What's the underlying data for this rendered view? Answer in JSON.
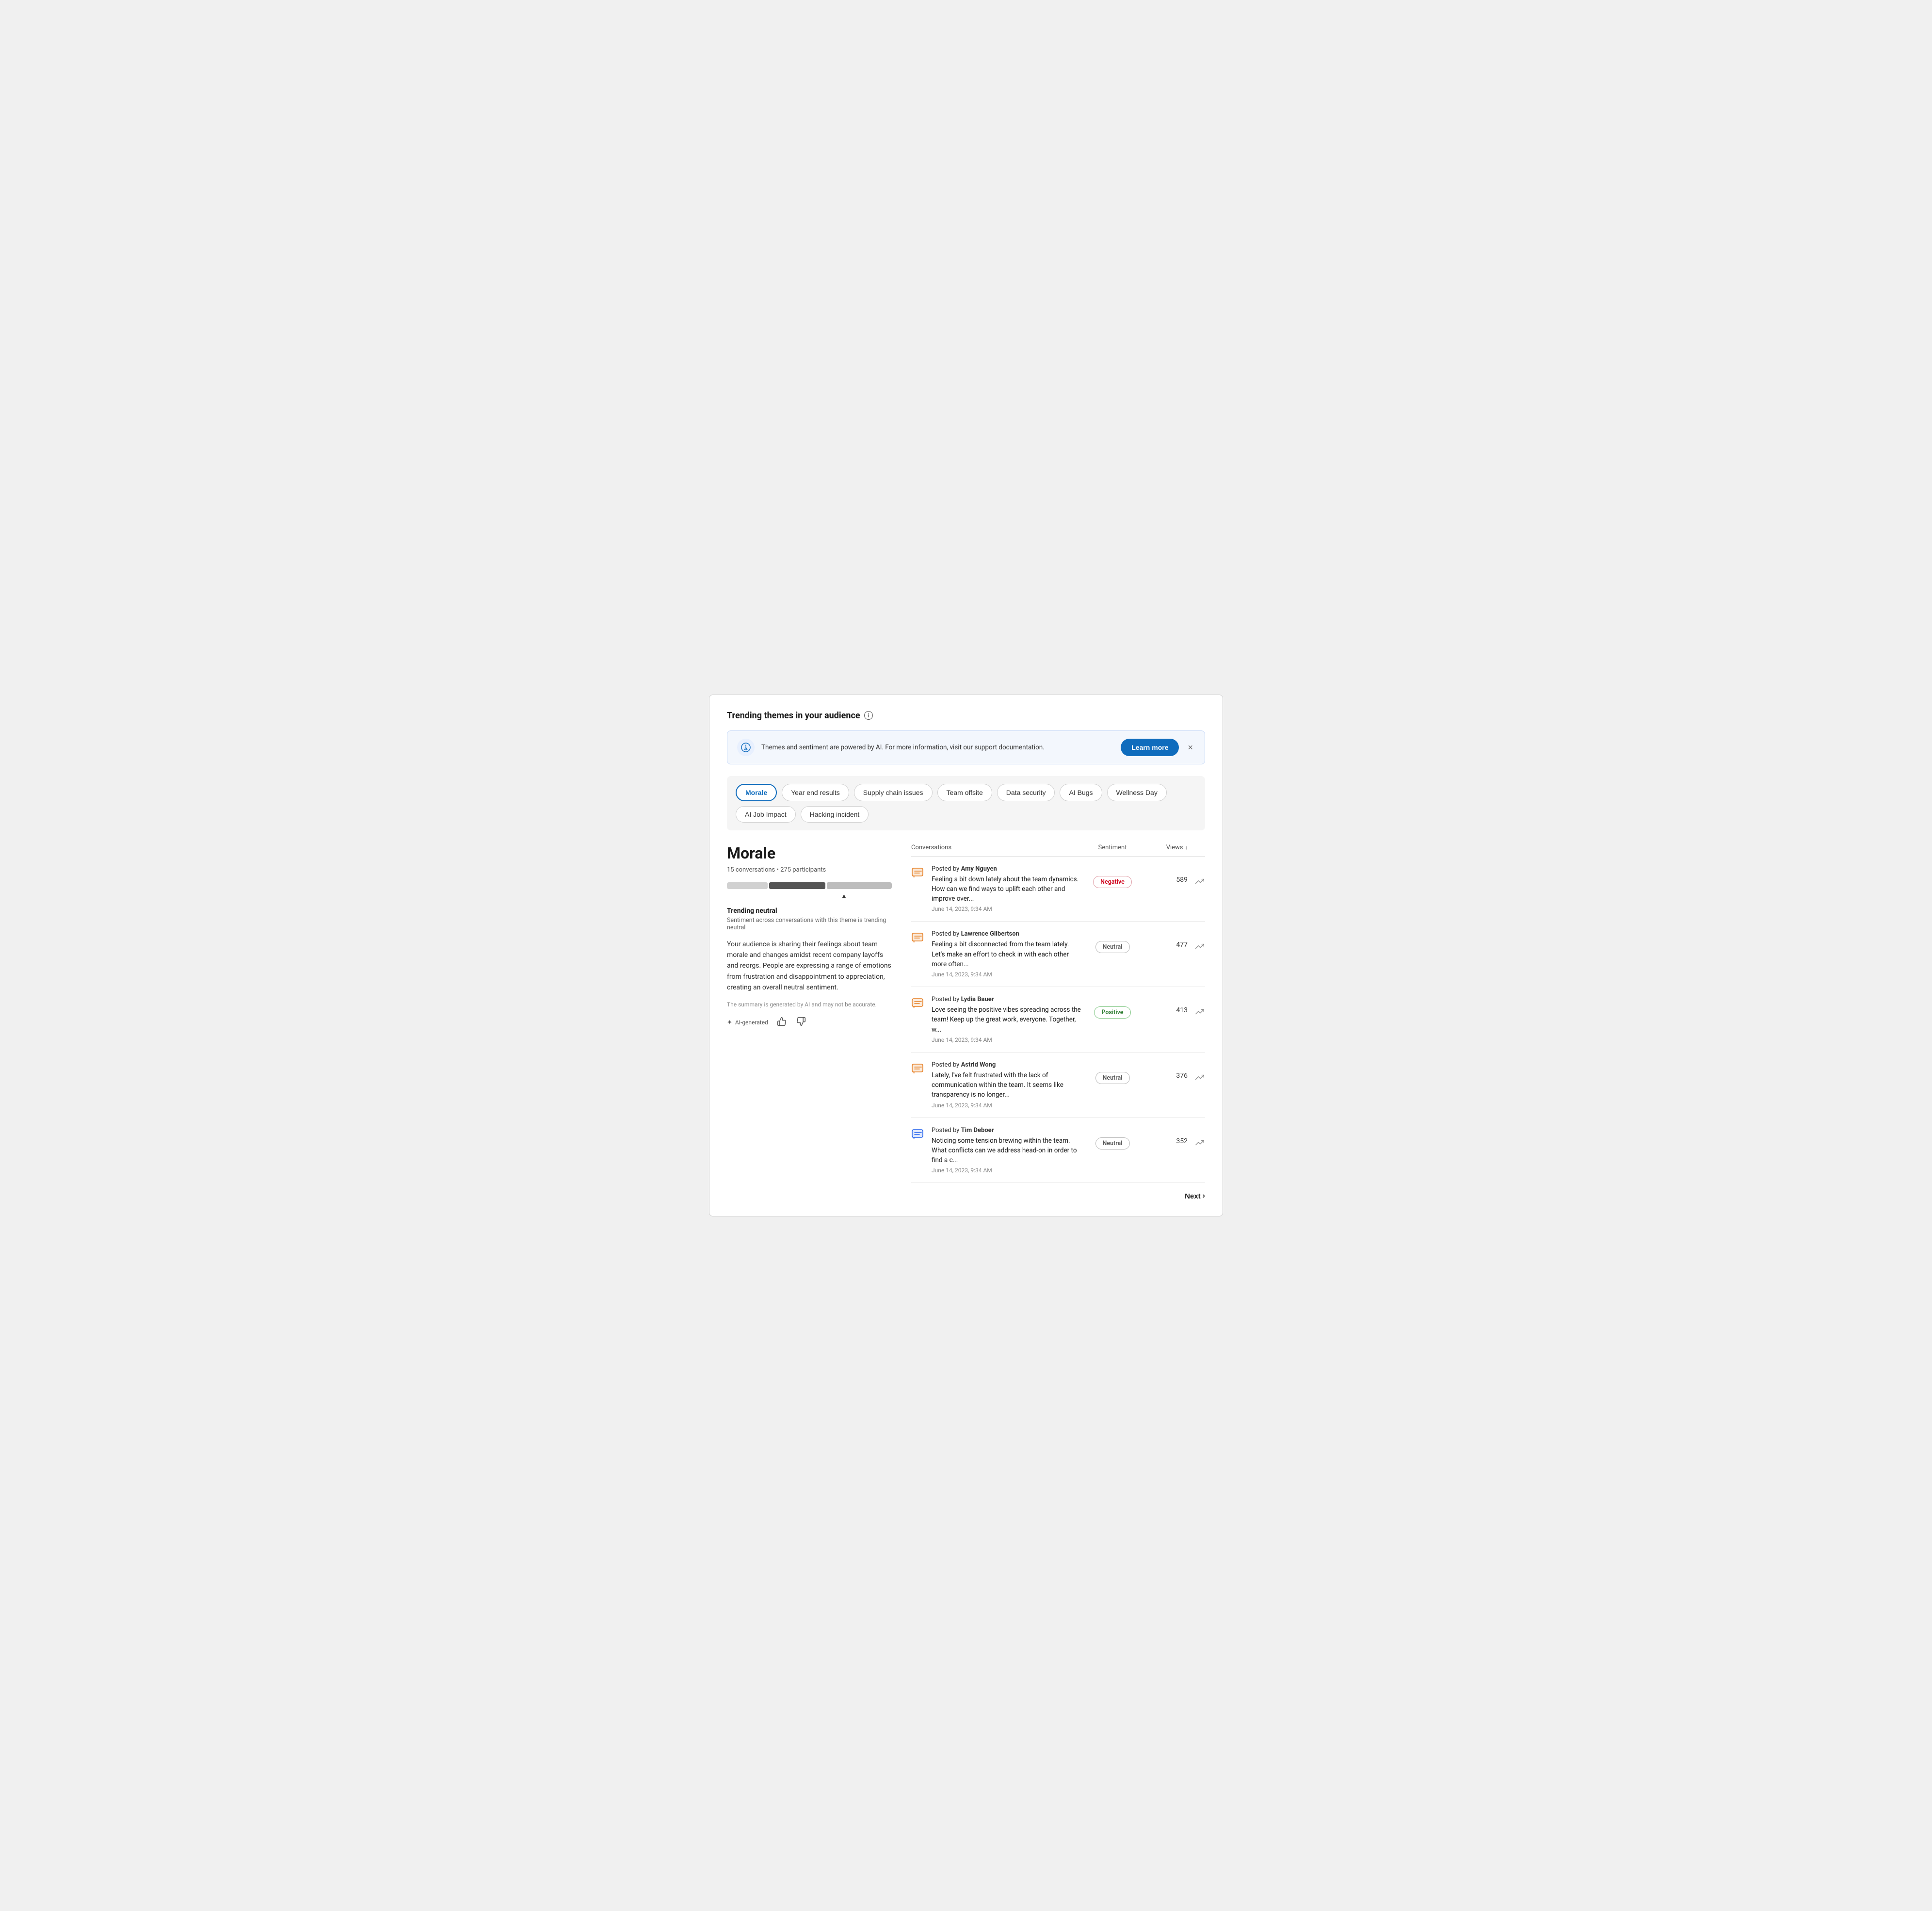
{
  "page": {
    "title": "Trending themes in your audience",
    "info_icon_label": "i"
  },
  "banner": {
    "text": "Themes and sentiment are powered by AI. For more information, visit our support documentation.",
    "learn_more_label": "Learn more",
    "close_label": "×"
  },
  "tabs": [
    {
      "id": "morale",
      "label": "Morale",
      "active": true
    },
    {
      "id": "year-end-results",
      "label": "Year end results",
      "active": false
    },
    {
      "id": "supply-chain-issues",
      "label": "Supply chain issues",
      "active": false
    },
    {
      "id": "team-offsite",
      "label": "Team offsite",
      "active": false
    },
    {
      "id": "data-security",
      "label": "Data security",
      "active": false
    },
    {
      "id": "ai-bugs",
      "label": "AI Bugs",
      "active": false
    },
    {
      "id": "wellness-day",
      "label": "Wellness Day",
      "active": false
    },
    {
      "id": "ai-job-impact",
      "label": "AI Job Impact",
      "active": false
    },
    {
      "id": "hacking-incident",
      "label": "Hacking incident",
      "active": false
    }
  ],
  "theme": {
    "name": "Morale",
    "conversations_count": "15 conversations",
    "participants_count": "275 participants",
    "trending_label": "Trending neutral",
    "trending_desc": "Sentiment across conversations with this theme is trending neutral",
    "description": "Your audience is sharing their feelings about team morale and changes amidst recent company layoffs and reorgs. People are expressing a range of emotions from frustration and disappointment to appreciation, creating an overall neutral sentiment.",
    "ai_disclaimer": "The summary is generated by AI and may not be accurate.",
    "ai_generated_label": "AI-generated",
    "thumbs_up_label": "👍",
    "thumbs_down_label": "👎"
  },
  "table": {
    "col_conversations": "Conversations",
    "col_sentiment": "Sentiment",
    "col_views": "Views",
    "sort_arrow": "↓",
    "rows": [
      {
        "author": "Amy Nguyen",
        "text": "Feeling a bit down lately about the team dynamics. How can we find ways to uplift each other and improve over...",
        "date": "June 14, 2023, 9:34 AM",
        "sentiment": "Negative",
        "sentiment_type": "negative",
        "views": "589",
        "icon_color": "orange"
      },
      {
        "author": "Lawrence Gilbertson",
        "text": "Feeling a bit disconnected from the team lately. Let's make an effort to check in with each other more often...",
        "date": "June 14, 2023, 9:34 AM",
        "sentiment": "Neutral",
        "sentiment_type": "neutral",
        "views": "477",
        "icon_color": "orange"
      },
      {
        "author": "Lydia Bauer",
        "text": "Love seeing the positive vibes spreading across the team! Keep up the great work, everyone. Together, w...",
        "date": "June 14, 2023, 9:34 AM",
        "sentiment": "Positive",
        "sentiment_type": "positive",
        "views": "413",
        "icon_color": "orange"
      },
      {
        "author": "Astrid Wong",
        "text": "Lately, I've felt frustrated with the lack of communication within the team. It seems like transparency is no longer...",
        "date": "June 14, 2023, 9:34 AM",
        "sentiment": "Neutral",
        "sentiment_type": "neutral",
        "views": "376",
        "icon_color": "orange"
      },
      {
        "author": "Tim Deboer",
        "text": "Noticing some tension brewing within the team. What conflicts can we address head-on in order to find a c...",
        "date": "June 14, 2023, 9:34 AM",
        "sentiment": "Neutral",
        "sentiment_type": "neutral",
        "views": "352",
        "icon_color": "blue"
      }
    ]
  },
  "pagination": {
    "next_label": "Next"
  }
}
